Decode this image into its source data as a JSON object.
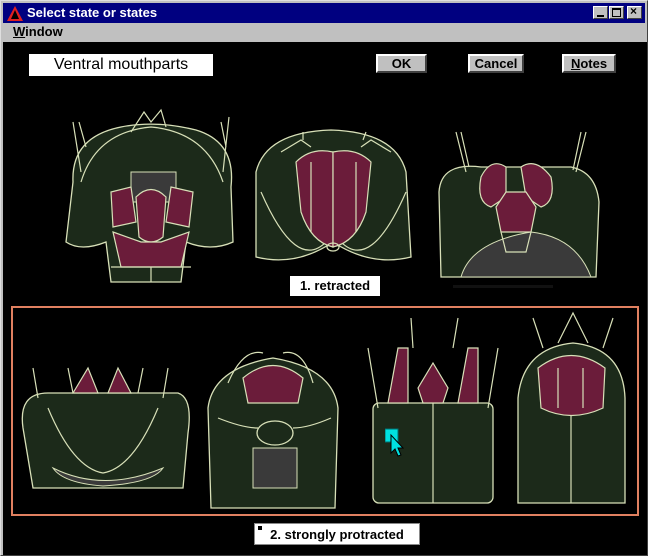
{
  "window": {
    "title": "Select state or states"
  },
  "menu": {
    "window_label": "Window",
    "window_mnemonic": "W",
    "window_rest": "indow"
  },
  "heading": "Ventral mouthparts",
  "buttons": {
    "ok": "OK",
    "cancel": "Cancel",
    "notes": "Notes",
    "notes_mnemonic": "N",
    "notes_rest": "otes"
  },
  "states": [
    {
      "label": "1. retracted",
      "selected": false
    },
    {
      "label": "2. strongly protracted",
      "selected": true
    }
  ],
  "colors": {
    "titlebar": "#000080",
    "selection_border": "#e08060",
    "cursor": "#00e0e0",
    "mouthpart": "#6b1c3a",
    "head": "#1c2a1a"
  }
}
